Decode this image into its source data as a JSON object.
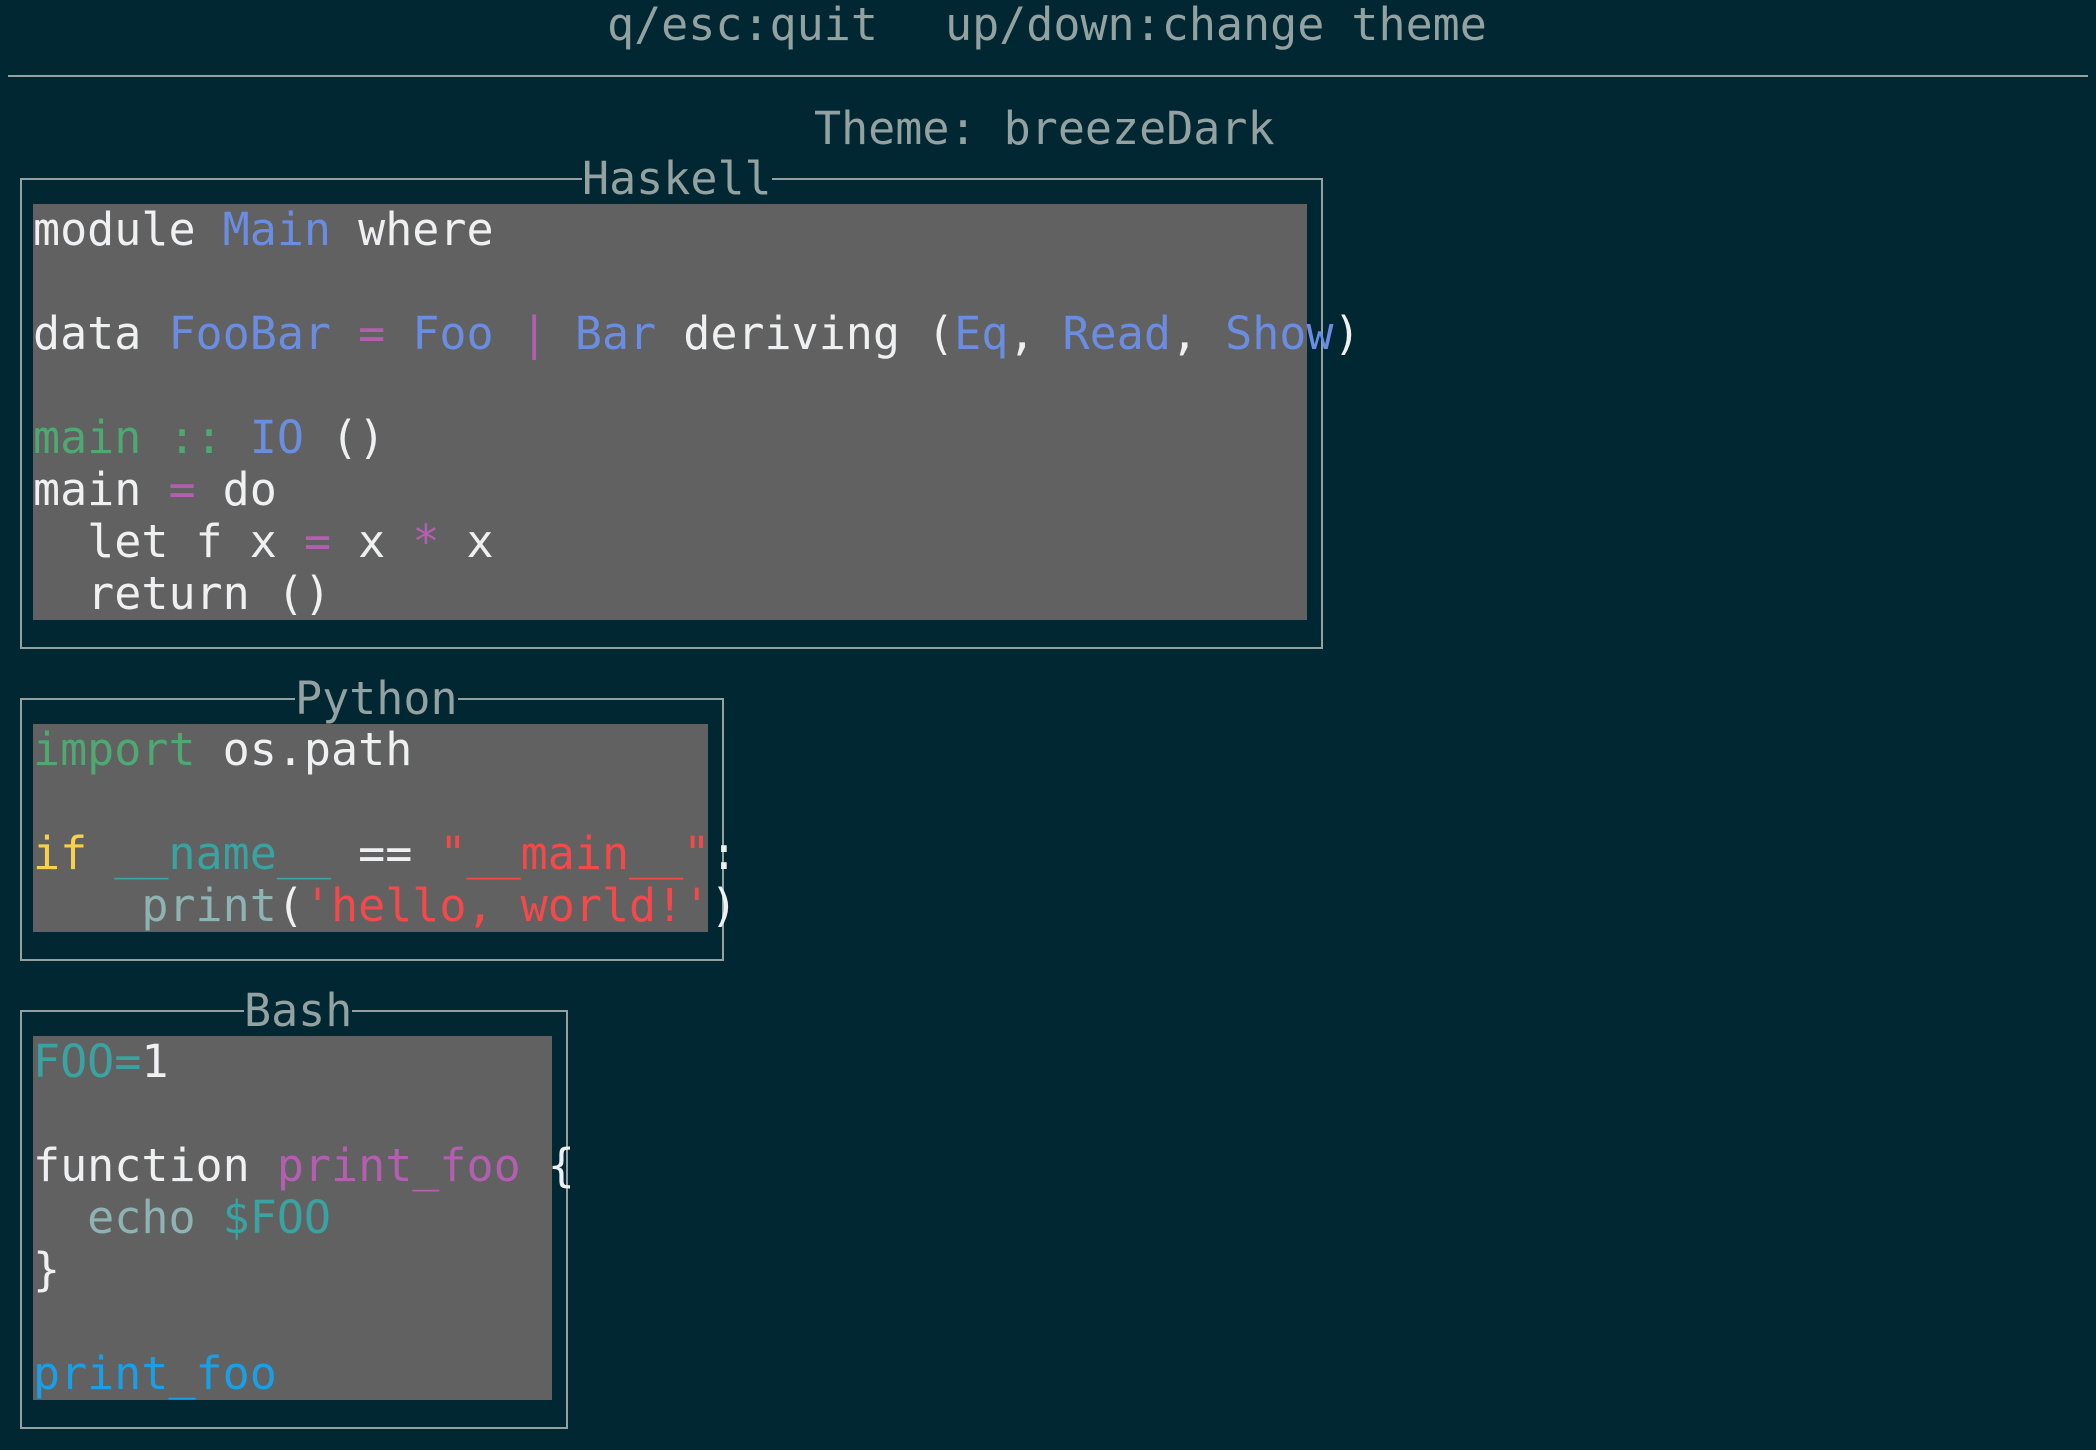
{
  "help_bar": {
    "quit": "q/esc:quit",
    "change": "up/down:change theme"
  },
  "theme": {
    "label": "Theme:",
    "name": "breezeDark"
  },
  "panels": {
    "haskell": {
      "title": "Haskell",
      "lines": [
        [
          {
            "t": "module ",
            "c": "kw"
          },
          {
            "t": "Main",
            "c": "type"
          },
          {
            "t": " where",
            "c": "kw"
          }
        ],
        [],
        [
          {
            "t": "data ",
            "c": "kw"
          },
          {
            "t": "FooBar",
            "c": "type"
          },
          {
            "t": " = ",
            "c": "op"
          },
          {
            "t": "Foo",
            "c": "type"
          },
          {
            "t": " | ",
            "c": "op"
          },
          {
            "t": "Bar",
            "c": "type"
          },
          {
            "t": " deriving (",
            "c": "kw"
          },
          {
            "t": "Eq",
            "c": "type"
          },
          {
            "t": ", ",
            "c": "kw"
          },
          {
            "t": "Read",
            "c": "type"
          },
          {
            "t": ", ",
            "c": "kw"
          },
          {
            "t": "Show",
            "c": "type"
          },
          {
            "t": ")",
            "c": "kw"
          }
        ],
        [],
        [
          {
            "t": "main",
            "c": "fn"
          },
          {
            "t": " :: ",
            "c": "fn"
          },
          {
            "t": "IO",
            "c": "type"
          },
          {
            "t": " ()",
            "c": "kw"
          }
        ],
        [
          {
            "t": "main ",
            "c": "kw"
          },
          {
            "t": "=",
            "c": "op"
          },
          {
            "t": " do",
            "c": "kw"
          }
        ],
        [
          {
            "t": "  let f x ",
            "c": "kw"
          },
          {
            "t": "=",
            "c": "op"
          },
          {
            "t": " x ",
            "c": "kw"
          },
          {
            "t": "*",
            "c": "op"
          },
          {
            "t": " x",
            "c": "kw"
          }
        ],
        [
          {
            "t": "  return ()",
            "c": "kw"
          }
        ]
      ]
    },
    "python": {
      "title": "Python",
      "lines": [
        [
          {
            "t": "import",
            "c": "fn"
          },
          {
            "t": " os.path",
            "c": "kw"
          }
        ],
        [],
        [
          {
            "t": "if",
            "c": "ctrl"
          },
          {
            "t": " ",
            "c": "kw"
          },
          {
            "t": "__name__",
            "c": "var"
          },
          {
            "t": " == ",
            "c": "kw"
          },
          {
            "t": "\"__main__\"",
            "c": "str"
          },
          {
            "t": ":",
            "c": "kw"
          }
        ],
        [
          {
            "t": "    ",
            "c": "kw"
          },
          {
            "t": "print",
            "c": "builtin"
          },
          {
            "t": "(",
            "c": "kw"
          },
          {
            "t": "'hello, world!'",
            "c": "str"
          },
          {
            "t": ")",
            "c": "kw"
          }
        ]
      ]
    },
    "bash": {
      "title": "Bash",
      "lines": [
        [
          {
            "t": "FOO=",
            "c": "bashvar"
          },
          {
            "t": "1",
            "c": "kw"
          }
        ],
        [],
        [
          {
            "t": "function ",
            "c": "kw"
          },
          {
            "t": "print_foo",
            "c": "bashfn"
          },
          {
            "t": " {",
            "c": "kw"
          }
        ],
        [
          {
            "t": "  echo ",
            "c": "builtin"
          },
          {
            "t": "$FOO",
            "c": "bashvar"
          }
        ],
        [
          {
            "t": "}",
            "c": "kw"
          }
        ],
        [],
        [
          {
            "t": "print_foo",
            "c": "call"
          }
        ]
      ]
    }
  },
  "colors": {
    "background": "#002732",
    "code_background": "#616161",
    "frame": "#93a1a1"
  }
}
